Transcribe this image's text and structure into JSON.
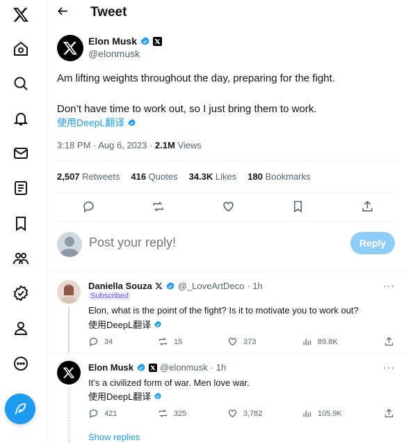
{
  "header": {
    "title": "Tweet"
  },
  "tweet": {
    "author_name": "Elon Musk",
    "author_handle": "@elonmusk",
    "text_line1": "Am lifting weights throughout the day, preparing for the fight.",
    "text_line2": "Don’t have time to work out, so I just bring them to work.",
    "translate": "使用DeepL翻译",
    "time": "3:18 PM · Aug 6, 2023 · ",
    "views_count": "2.1M",
    "views_label": " Views",
    "retweets_count": "2,507",
    "retweets_label": " Retweets",
    "quotes_count": "416",
    "quotes_label": " Quotes",
    "likes_count": "34.3K",
    "likes_label": " Likes",
    "bookmarks_count": "180",
    "bookmarks_label": " Bookmarks"
  },
  "reply_box": {
    "placeholder": "Post your reply!",
    "button": "Reply"
  },
  "replies": [
    {
      "name": "Daniella Souza",
      "handle": "@_LoveArtDeco",
      "time": "· 1h",
      "badge": "Subscribed",
      "text": "Elon, what is the point of the fight? Is it to motivate you to work out?",
      "translate": "使用DeepL翻译",
      "replies": "34",
      "retweets": "15",
      "likes": "373",
      "views": "89.8K"
    },
    {
      "name": "Elon Musk",
      "handle": "@elonmusk",
      "time": "· 1h",
      "text": "It’s a civilized form of war. Men love war.",
      "translate": "使用DeepL翻译",
      "replies": "421",
      "retweets": "325",
      "likes": "3,782",
      "views": "105.9K"
    }
  ],
  "show_replies": "Show replies",
  "colors": {
    "accent": "#1d9bf0",
    "text": "#0f1419",
    "muted": "#536471"
  }
}
